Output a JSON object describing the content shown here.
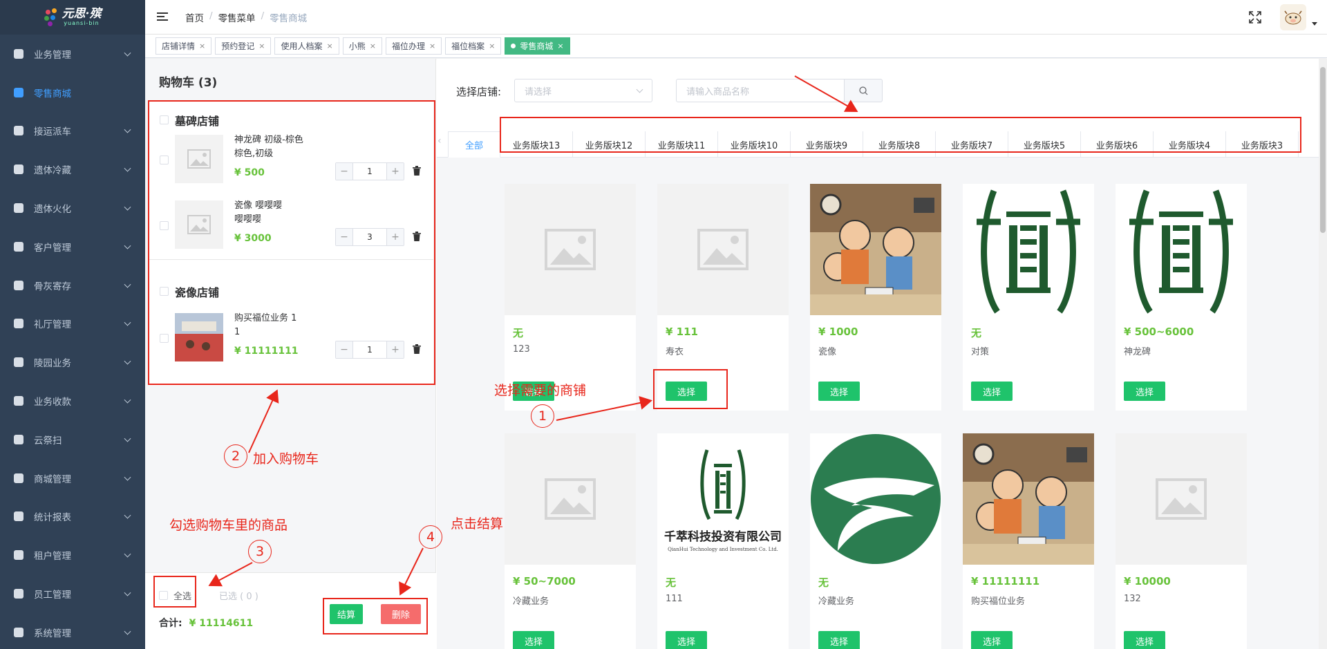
{
  "logo": {
    "title": "元思·殡",
    "subtitle": "yuansi-bin"
  },
  "sidebar": {
    "items": [
      {
        "label": "业务管理",
        "active": false
      },
      {
        "label": "零售商城",
        "active": true
      },
      {
        "label": "接运派车",
        "active": false
      },
      {
        "label": "遗体冷藏",
        "active": false
      },
      {
        "label": "遗体火化",
        "active": false
      },
      {
        "label": "客户管理",
        "active": false
      },
      {
        "label": "骨灰寄存",
        "active": false
      },
      {
        "label": "礼厅管理",
        "active": false
      },
      {
        "label": "陵园业务",
        "active": false
      },
      {
        "label": "业务收款",
        "active": false
      },
      {
        "label": "云祭扫",
        "active": false
      },
      {
        "label": "商城管理",
        "active": false
      },
      {
        "label": "统计报表",
        "active": false
      },
      {
        "label": "租户管理",
        "active": false
      },
      {
        "label": "员工管理",
        "active": false
      },
      {
        "label": "系统管理",
        "active": false
      }
    ]
  },
  "breadcrumb": {
    "home": "首页",
    "menu": "零售菜单",
    "current": "零售商城",
    "sep": "/"
  },
  "tags": [
    {
      "label": "店铺详情",
      "close": "×"
    },
    {
      "label": "预约登记",
      "close": "×"
    },
    {
      "label": "使用人档案",
      "close": "×"
    },
    {
      "label": "小熊",
      "close": "×"
    },
    {
      "label": "福位办理",
      "close": "×"
    },
    {
      "label": "福位档案",
      "close": "×"
    },
    {
      "label": "零售商城",
      "close": "×"
    }
  ],
  "cart": {
    "title": "购物车 (3)",
    "shops": [
      {
        "name": "墓碑店铺",
        "items": [
          {
            "name": "神龙碑 初级-棕色\n棕色,初级",
            "price": "¥ 500",
            "qty": "1"
          },
          {
            "name": "瓷像 嘤嘤嘤\n嘤嘤嘤",
            "price": "¥ 3000",
            "qty": "3"
          }
        ]
      },
      {
        "name": "瓷像店铺",
        "items": [
          {
            "name": "购买福位业务 1\n1",
            "price": "¥ 11111111",
            "qty": "1"
          }
        ]
      }
    ],
    "stepper": {
      "minus": "−",
      "plus": "+"
    },
    "select_all": "全选",
    "selected": "已选 ( 0 )",
    "total_label": "合计:",
    "total_amount": "¥ 11114611",
    "checkout": "结算",
    "delete": "删除"
  },
  "search": {
    "shop_label": "选择店铺:",
    "shop_placeholder": "请选择",
    "product_placeholder": "请输入商品名称"
  },
  "tabs": [
    "全部",
    "业务版块13",
    "业务版块12",
    "业务版块11",
    "业务版块10",
    "业务版块9",
    "业务版块8",
    "业务版块7",
    "业务版块5",
    "业务版块6",
    "业务版块4",
    "业务版块3"
  ],
  "products": [
    {
      "price": "无",
      "name": "123",
      "image": "placeholder",
      "button": "选择"
    },
    {
      "price": "¥ 111",
      "name": "寿衣",
      "image": "placeholder",
      "button": "选择"
    },
    {
      "price": "¥ 1000",
      "name": "瓷像",
      "image": "cartoon",
      "button": "选择"
    },
    {
      "price": "无",
      "name": "对策",
      "image": "gate-logo",
      "button": "选择"
    },
    {
      "price": "¥ 500~6000",
      "name": "神龙碑",
      "image": "gate-logo",
      "button": "选择"
    },
    {
      "price": "¥ 50~7000",
      "name": "冷藏业务",
      "image": "placeholder",
      "button": "选择"
    },
    {
      "price": "无",
      "name": "111",
      "image": "company-logo",
      "button": "选择"
    },
    {
      "price": "无",
      "name": "冷藏业务",
      "image": "dragon-circle",
      "button": "选择"
    },
    {
      "price": "¥ 11111111",
      "name": "购买福位业务",
      "image": "cartoon",
      "button": "选择"
    },
    {
      "price": "¥ 10000",
      "name": "132",
      "image": "placeholder",
      "button": "选择"
    }
  ],
  "company_logo": {
    "name": "千萃科技投资有限公司",
    "sub": "QianHui Technology and Investment Co. Ltd."
  },
  "annotations": [
    {
      "num": "①",
      "text": "选择需要的商铺"
    },
    {
      "num": "②",
      "text": "加入购物车"
    },
    {
      "num": "③",
      "text": "勾选购物车里的商品"
    },
    {
      "num": "④",
      "text": "点击结算"
    }
  ],
  "colors": {
    "sidebar_bg": "#304156",
    "active": "#409eff",
    "green": "#1fc36b",
    "price_green": "#67c23a",
    "red": "#f56c6c",
    "annotation": "#e8261b"
  }
}
